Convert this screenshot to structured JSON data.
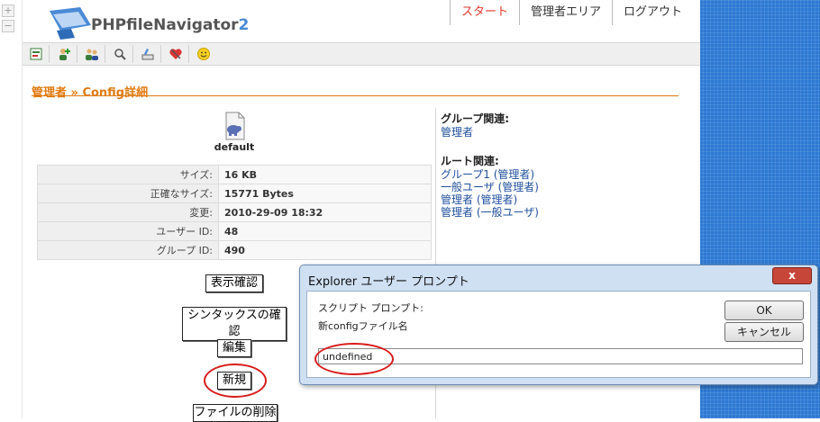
{
  "app": {
    "logo_text": "PHPfileNavigator",
    "logo_suffix": "2"
  },
  "topnav": {
    "items": [
      "スタート",
      "管理者エリア",
      "ログアウト"
    ],
    "active_index": 0
  },
  "toolbar": {
    "icons": [
      "config-icon",
      "add-user-icon",
      "users-icon",
      "search-icon",
      "settings-icon",
      "favorites-icon",
      "smiley-icon"
    ]
  },
  "breadcrumb": "管理者 » Config詳細",
  "file": {
    "name": "default"
  },
  "info": [
    {
      "key": "サイズ:",
      "value": "16 KB"
    },
    {
      "key": "正確なサイズ:",
      "value": "15771 Bytes"
    },
    {
      "key": "変更:",
      "value": "2010-29-09 18:32"
    },
    {
      "key": "ユーザー ID:",
      "value": "48"
    },
    {
      "key": "グループ ID:",
      "value": "490"
    }
  ],
  "related": {
    "group_title": "グループ関連:",
    "groups": [
      "管理者"
    ],
    "root_title": "ルート関連:",
    "roots": [
      "グループ1 (管理者)",
      "一般ユーザ (管理者)",
      "管理者 (管理者)",
      "管理者 (一般ユーザ)"
    ]
  },
  "actions": {
    "view": "表示確認",
    "syntax": "シンタックスの確認",
    "edit": "編集",
    "new": "新規",
    "delete": "ファイルの削除"
  },
  "dialog": {
    "title": "Explorer ユーザー プロンプト",
    "close_label": "x",
    "prompt_label": "スクリプト プロンプト:",
    "prompt_text": "新configファイル名",
    "ok_label": "OK",
    "cancel_label": "キャンセル",
    "input_value": "undefined"
  }
}
